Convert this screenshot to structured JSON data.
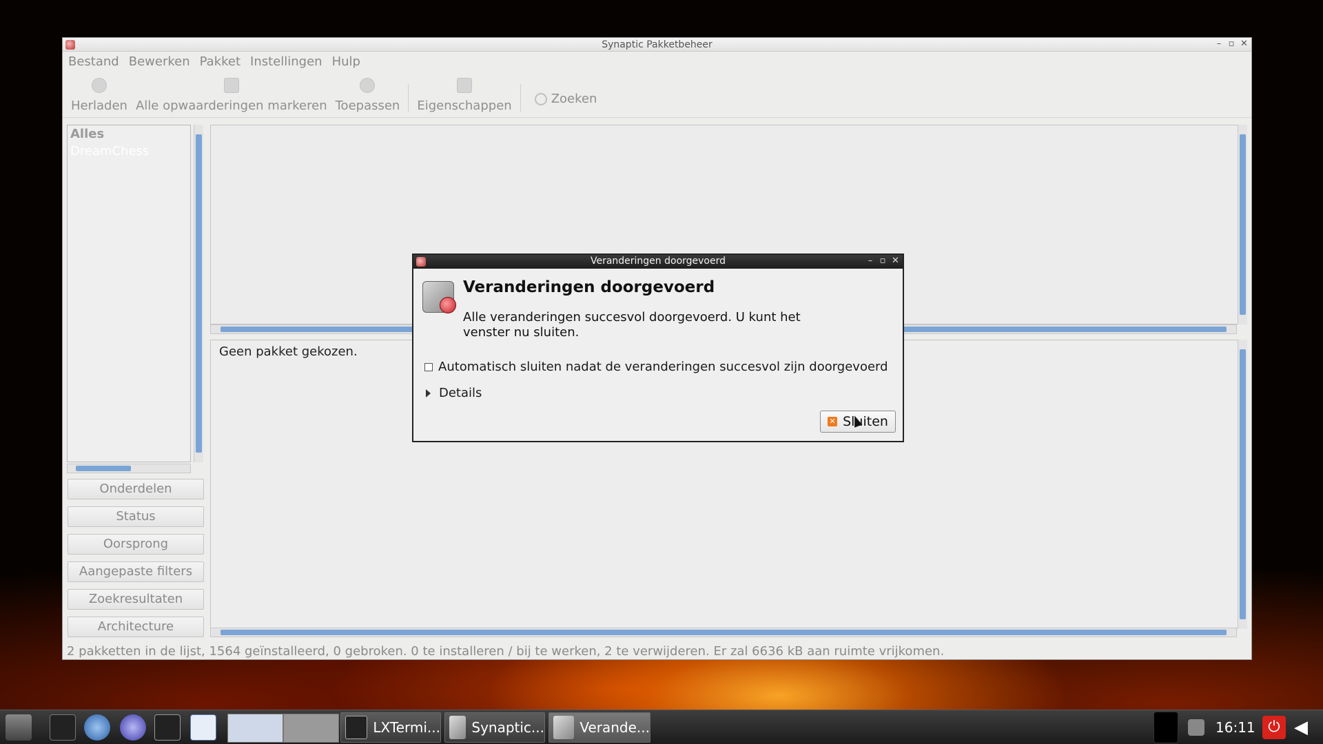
{
  "main_window": {
    "title": "Synaptic Pakketbeheer",
    "menu": [
      "Bestand",
      "Bewerken",
      "Pakket",
      "Instellingen",
      "Hulp"
    ],
    "toolbar": {
      "reload": "Herladen",
      "mark_all_upgrades": "Alle opwaarderingen markeren",
      "apply": "Toepassen",
      "properties": "Eigenschappen",
      "search": "Zoeken"
    },
    "filters": {
      "all": "Alles",
      "selected": "DreamChess"
    },
    "side_buttons": {
      "sections": "Onderdelen",
      "status": "Status",
      "origin": "Oorsprong",
      "custom_filters": "Aangepaste filters",
      "search_results": "Zoekresultaten",
      "architecture": "Architecture"
    },
    "details_text": "Geen pakket gekozen.",
    "status_bar": "2 pakketten in de lijst, 1564 geïnstalleerd, 0 gebroken. 0 te installeren / bij te werken, 2 te verwijderen. Er zal 6636 kB aan ruimte vrijkomen."
  },
  "dialog": {
    "title": "Veranderingen doorgevoerd",
    "heading": "Veranderingen doorgevoerd",
    "message": "Alle veranderingen succesvol doorgevoerd. U kunt het venster nu sluiten.",
    "auto_close_label": "Automatisch sluiten nadat de veranderingen succesvol zijn doorgevoerd",
    "auto_close_checked": false,
    "details_label": "Details",
    "close_label": "Sluiten"
  },
  "taskbar": {
    "tasks": [
      "LXTermi...",
      "Synaptic...",
      "Verande..."
    ],
    "clock": "16:11"
  },
  "colors": {
    "accent_scrollbar": "#7aa4d6",
    "dialog_titlebar": "#222222",
    "power": "#d9221c"
  }
}
